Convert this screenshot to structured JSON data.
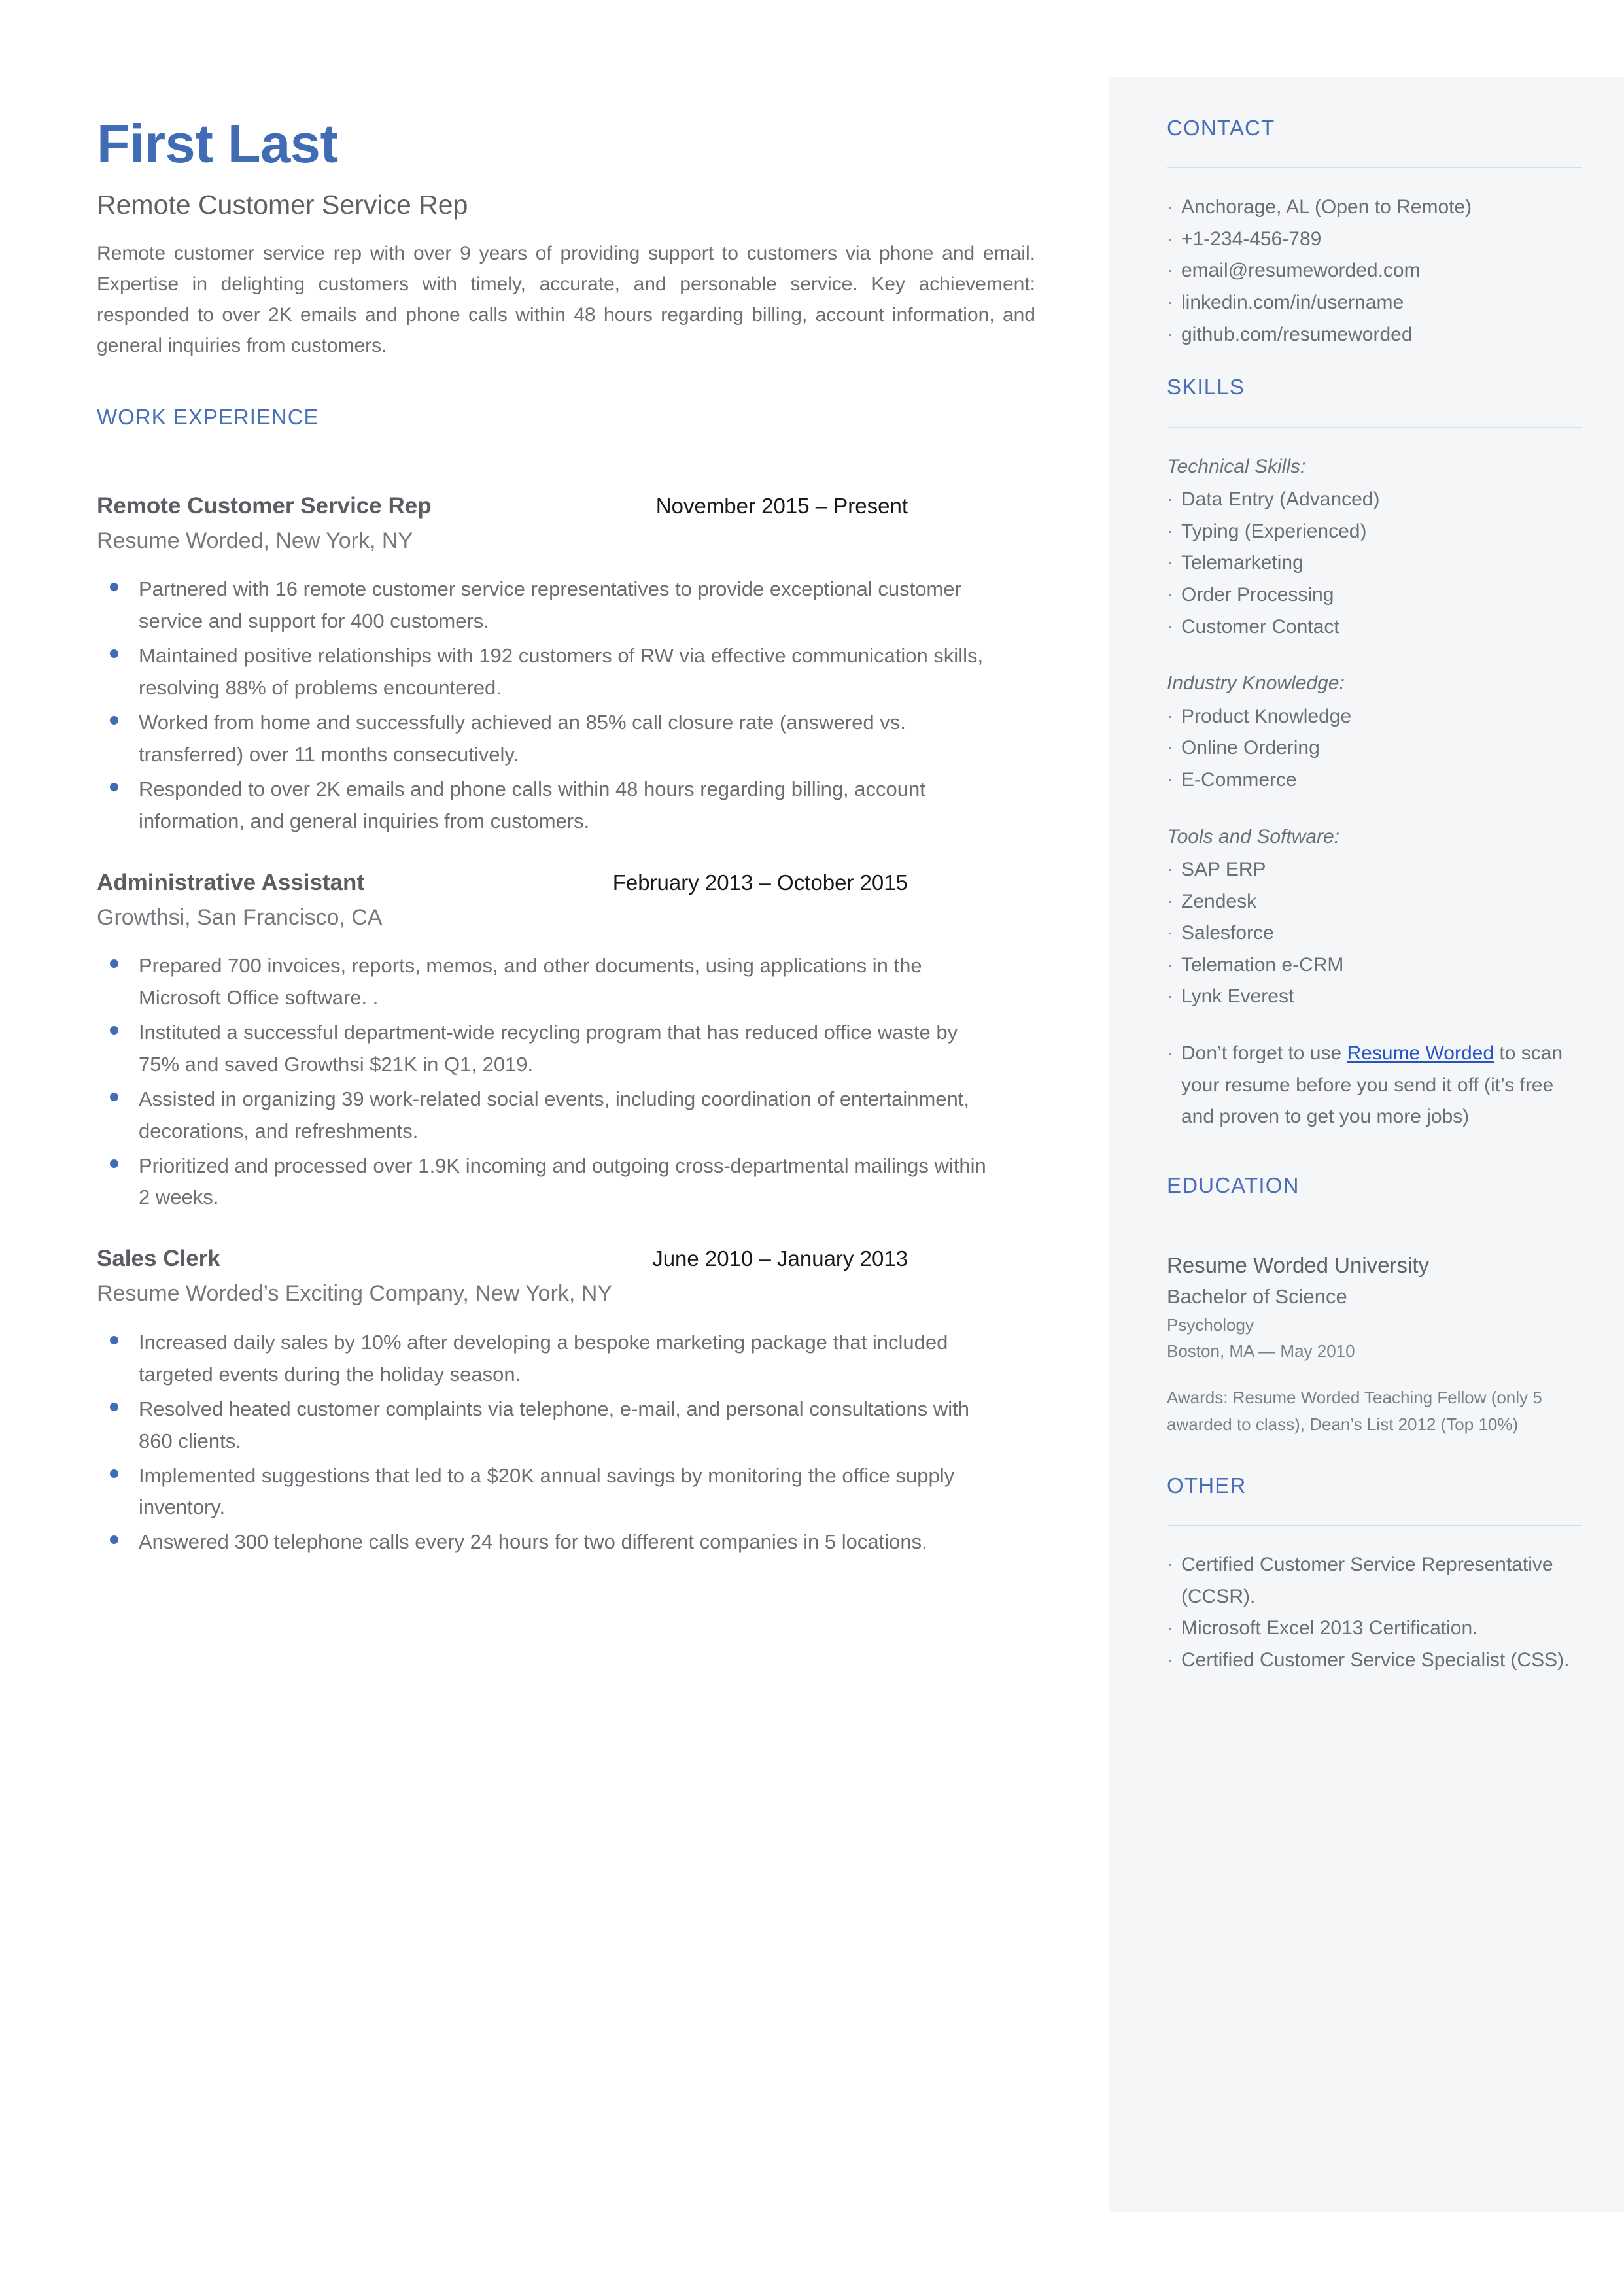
{
  "header": {
    "name": "First Last",
    "subtitle": "Remote Customer Service Rep",
    "summary": "Remote customer service rep with over 9 years of providing support to customers via phone and email. Expertise in delighting customers with timely, accurate, and personable service. Key achievement: responded to over 2K emails and phone calls within 48 hours regarding billing, account information, and general inquiries from customers."
  },
  "work": {
    "heading": "WORK EXPERIENCE",
    "jobs": [
      {
        "title": "Remote Customer Service Rep",
        "dates": "November 2015 – Present",
        "company": "Resume Worded, New York, NY",
        "bullets": [
          "Partnered with 16 remote customer service representatives to provide exceptional customer service and support for 400 customers.",
          "Maintained positive relationships with 192 customers of RW via effective communication skills, resolving 88% of problems encountered.",
          "Worked from home and successfully achieved an 85% call closure rate (answered vs. transferred) over 11 months consecutively.",
          "Responded to over 2K emails and phone calls within 48 hours regarding billing, account information, and general inquiries from customers."
        ]
      },
      {
        "title": "Administrative Assistant",
        "dates": "February 2013 – October 2015",
        "company": "Growthsi, San Francisco, CA",
        "bullets": [
          "Prepared 700 invoices, reports, memos, and other documents, using applications in the Microsoft Office software. .",
          "Instituted a successful department-wide recycling program that has reduced office waste by 75% and saved Growthsi $21K in Q1, 2019.",
          "Assisted in organizing 39 work-related social events, including coordination of entertainment, decorations, and refreshments.",
          "Prioritized and processed over 1.9K incoming and outgoing cross-departmental mailings within 2 weeks."
        ]
      },
      {
        "title": "Sales Clerk",
        "dates": "June 2010 – January 2013",
        "company": "Resume Worded’s Exciting Company, New York, NY",
        "bullets": [
          "Increased daily sales by 10% after developing a bespoke marketing package that included targeted events during the holiday season.",
          "Resolved heated customer complaints via telephone, e-mail, and personal consultations with 860 clients.",
          "Implemented suggestions that led to a $20K annual savings by monitoring the office supply inventory.",
          "Answered 300 telephone calls every 24 hours for two different companies in 5 locations."
        ]
      }
    ]
  },
  "sidebar": {
    "contact": {
      "heading": "CONTACT",
      "items": [
        "Anchorage, AL (Open to Remote)",
        "+1-234-456-789",
        "email@resumeworded.com",
        "linkedin.com/in/username",
        "github.com/resumeworded"
      ]
    },
    "skills": {
      "heading": "SKILLS",
      "groups": [
        {
          "label": "Technical Skills:",
          "items": [
            "Data Entry (Advanced)",
            "Typing (Experienced)",
            "Telemarketing",
            "Order Processing",
            "Customer Contact"
          ]
        },
        {
          "label": "Industry Knowledge:",
          "items": [
            "Product Knowledge",
            "Online Ordering",
            "E-Commerce"
          ]
        },
        {
          "label": "Tools and Software:",
          "items": [
            "SAP ERP",
            "Zendesk",
            "Salesforce",
            "Telemation e-CRM",
            "Lynk Everest"
          ]
        }
      ],
      "promo": {
        "before": "Don’t forget to use ",
        "link": "Resume Worded",
        "after": " to scan your resume before you send it off (it’s free and proven to get you more jobs)"
      }
    },
    "education": {
      "heading": "EDUCATION",
      "school": "Resume Worded University",
      "degree": "Bachelor of Science",
      "field": "Psychology",
      "place": "Boston, MA — May 2010",
      "awards": "Awards: Resume Worded Teaching Fellow (only 5 awarded to class), Dean’s List 2012 (Top 10%)"
    },
    "other": {
      "heading": "OTHER",
      "items": [
        "Certified Customer Service Representative (CCSR).",
        "Microsoft Excel 2013 Certification.",
        "Certified Customer Service Specialist (CSS)."
      ]
    }
  },
  "colors": {
    "accent": "#4a6fb5",
    "name": "#3f6cb4",
    "link": "#2554c7",
    "sidebar_bg": "#f4f6f8",
    "rule": "#d8dde3",
    "body_text": "#6b6f73"
  }
}
